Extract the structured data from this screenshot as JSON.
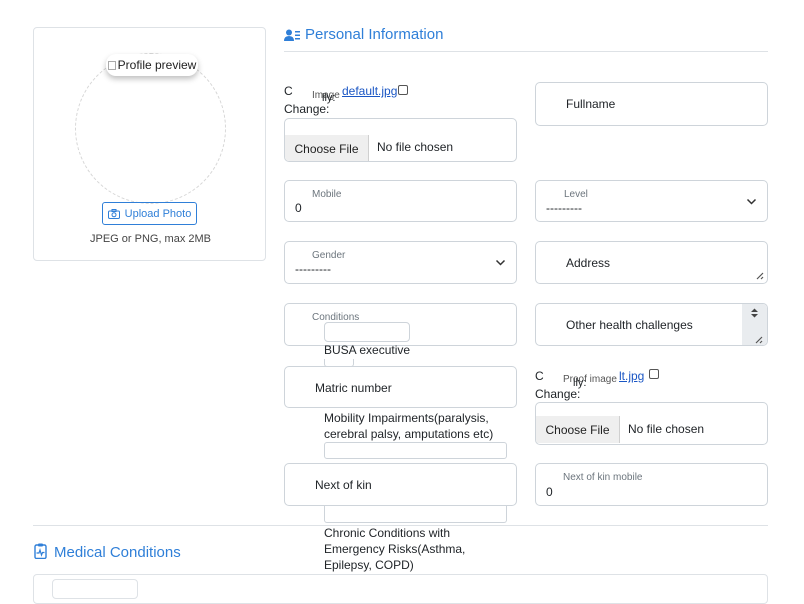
{
  "profile": {
    "image_alt": "Profile preview",
    "upload_label": "Upload Photo",
    "hint": "JPEG or PNG, max 2MB"
  },
  "personal": {
    "title": "Personal Information",
    "image": {
      "label": "Image",
      "currently_prefix": "C",
      "currently_tail": "lly:",
      "file_link": "default.jpg",
      "change": "Change:",
      "choose_file": "Choose File",
      "no_file": "No file chosen"
    },
    "fullname": "Fullname",
    "mobile": {
      "label": "Mobile",
      "value": "0"
    },
    "level": {
      "label": "Level",
      "value": "---------"
    },
    "gender": {
      "label": "Gender",
      "value": "---------"
    },
    "address": "Address",
    "conditions_label": "Conditions",
    "conditions_items": [
      "BUSA executive",
      "Mobility Impairments(paralysis, cerebral palsy, amputations etc)",
      "Chronic Conditions with Emergency Risks(Asthma, Epilepsy, COPD)"
    ],
    "other_health": "Other health challenges",
    "matric": "Matric number",
    "proof": {
      "label": "Proof image",
      "currently_prefix": "C",
      "currently_tail": "lly:",
      "file_link": "default.jpg",
      "file_link_visible": "lt.jpg",
      "change": "Change:",
      "choose_file": "Choose File",
      "no_file": "No file chosen"
    },
    "next_of_kin": "Next of kin",
    "next_of_kin_mobile": {
      "label": "Next of kin mobile",
      "value": "0"
    }
  },
  "medical": {
    "title": "Medical Conditions"
  },
  "colors": {
    "accent": "#2f7fd8",
    "border": "#ced4da"
  }
}
